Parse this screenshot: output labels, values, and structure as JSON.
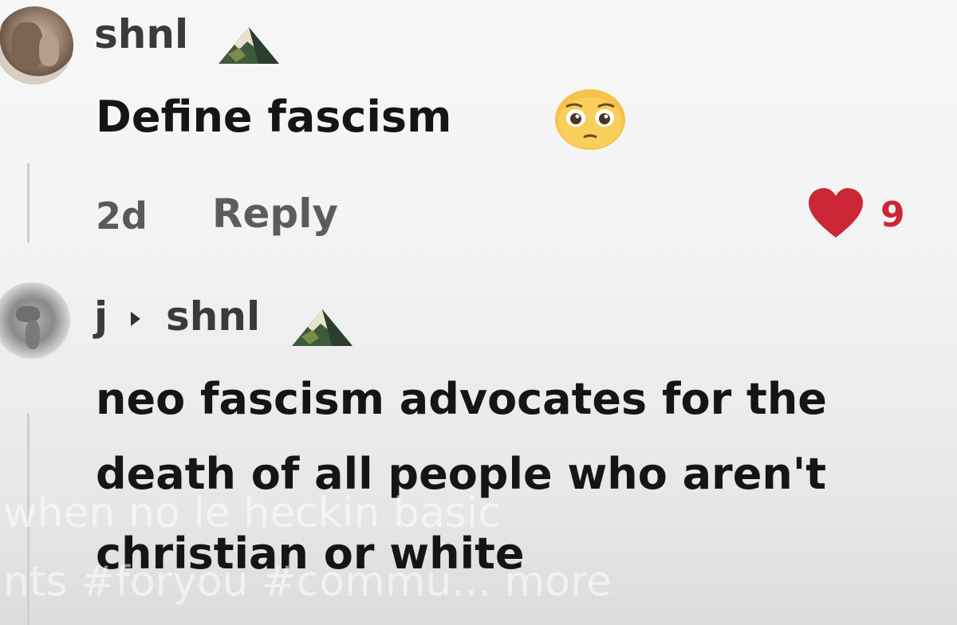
{
  "comments": [
    {
      "username": "shnl",
      "text": "Define fascism",
      "time": "2d",
      "reply_label": "Reply",
      "likes": "9",
      "liked": true
    },
    {
      "username": "j",
      "reply_to": "shnl",
      "lines": [
        "neo fascism advocates for the",
        "death of all people who aren't",
        "christian or white"
      ]
    }
  ],
  "video_caption": {
    "line1": "when no le heckin basic",
    "line2": "nts #foryou #commu... more"
  },
  "colors": {
    "heart": "#cc2636",
    "username": "#3a3a3a",
    "meta": "#5a5a5a"
  },
  "icons": {
    "badge": "mountain-icon",
    "emoji": "pleading-face-emoji",
    "like": "heart-icon",
    "reply_arrow": "triangle-right-icon"
  }
}
